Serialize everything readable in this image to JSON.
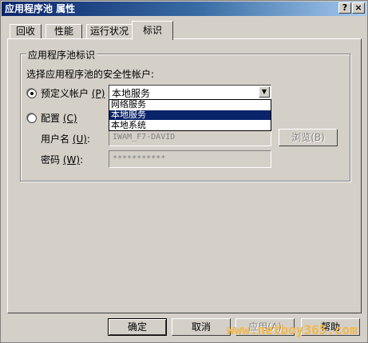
{
  "window": {
    "title": "应用程序池 属性",
    "help_glyph": "?",
    "close_glyph": "×"
  },
  "tabs": [
    {
      "label": "回收"
    },
    {
      "label": "性能"
    },
    {
      "label": "运行状况"
    },
    {
      "label": "标识",
      "active": true
    }
  ],
  "identity": {
    "group_title": "应用程序池标识",
    "prompt": "选择应用程序池的安全性帐户:",
    "predefined": {
      "label": "预定义帐户",
      "accel": "(P)",
      "selected": true
    },
    "account_select": {
      "value": "本地服务",
      "options": [
        "网络服务",
        "本地服务",
        "本地系统"
      ],
      "highlighted": "本地服务"
    },
    "configurable": {
      "label": "配置",
      "accel": "(C)",
      "selected": false
    },
    "username": {
      "label": "用户名",
      "accel": "(U)",
      "colon": ":",
      "value": "IWAM_F7-DAVID"
    },
    "browse_button": "浏览(B)",
    "password": {
      "label": "密码",
      "accel": "(W)",
      "colon": ":",
      "value": "***********"
    }
  },
  "footer": {
    "ok": "确定",
    "cancel": "取消",
    "apply": "应用(A)",
    "help": "帮助"
  },
  "watermark": "www.netboy365.com",
  "colors": {
    "title_bar": "#0a246a",
    "face": "#d4d0c8",
    "highlight": "#0a246a",
    "watermark": "#f2b84a"
  }
}
